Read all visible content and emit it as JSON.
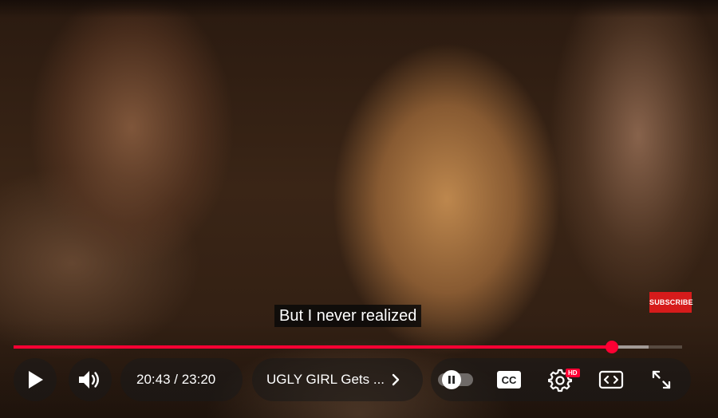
{
  "video": {
    "caption": "But I never realized",
    "subscribe_label": "SUBSCRIBE"
  },
  "progress": {
    "played_fraction": 0.895,
    "buffered_fraction": 0.95
  },
  "controls": {
    "current_time": "20:43",
    "separator": " / ",
    "duration": "23:20",
    "video_title": "UGLY GIRL Gets ...",
    "quality_badge": "HD",
    "colors": {
      "accent": "#ff0033"
    },
    "icons": [
      "play-icon",
      "volume-icon",
      "chevron-right-icon",
      "pause-icon",
      "cc-icon",
      "settings-icon",
      "miniplayer-icon",
      "fullscreen-icon"
    ]
  }
}
